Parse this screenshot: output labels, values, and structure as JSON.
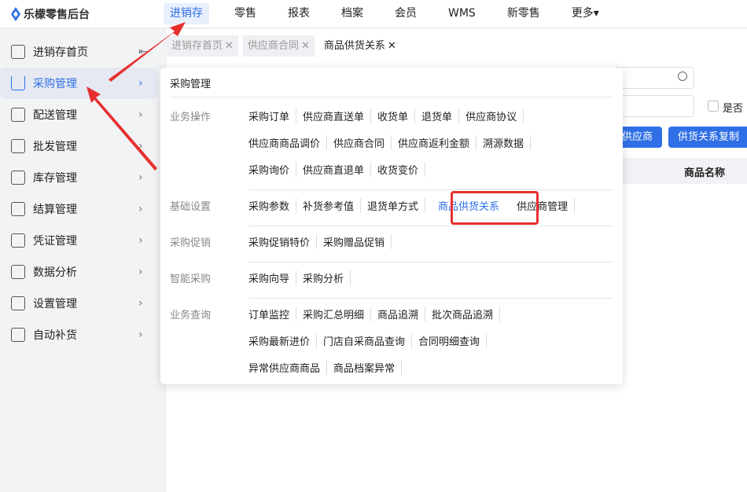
{
  "app": {
    "title": "乐檬零售后台",
    "brand_color": "#2f6fe6"
  },
  "nav": [
    {
      "label": "进销存",
      "active": true
    },
    {
      "label": "零售"
    },
    {
      "label": "报表"
    },
    {
      "label": "档案"
    },
    {
      "label": "会员"
    },
    {
      "label": "WMS"
    },
    {
      "label": "新零售"
    },
    {
      "label": "更多▾"
    }
  ],
  "sidebar": [
    {
      "label": "进销存首页",
      "icon": "home-icon"
    },
    {
      "label": "采购管理",
      "icon": "cart-icon",
      "active": true
    },
    {
      "label": "配送管理",
      "icon": "map-icon"
    },
    {
      "label": "批发管理",
      "icon": "server-icon"
    },
    {
      "label": "库存管理",
      "icon": "box-icon"
    },
    {
      "label": "结算管理",
      "icon": "dollar-icon"
    },
    {
      "label": "凭证管理",
      "icon": "document-icon"
    },
    {
      "label": "数据分析",
      "icon": "chart-icon"
    },
    {
      "label": "设置管理",
      "icon": "settings-icon"
    },
    {
      "label": "自动补货",
      "icon": "replenish-icon"
    }
  ],
  "tabs": [
    {
      "label": "进销存首页"
    },
    {
      "label": "供应商合同"
    },
    {
      "label": "商品供货关系",
      "active": true
    }
  ],
  "page": {
    "checkbox_label": "是否",
    "buttons": [
      "供应商",
      "供货关系复制"
    ],
    "column_header": "商品名称"
  },
  "menu": {
    "title": "采购管理",
    "sections": [
      {
        "label": "业务操作",
        "rows": [
          [
            "采购订单",
            "供应商直送单",
            "收货单",
            "退货单",
            "供应商协议"
          ],
          [
            "供应商商品调价",
            "供应商合同",
            "供应商返利金额",
            "溯源数据"
          ],
          [
            "采购询价",
            "供应商直退单",
            "收货变价"
          ]
        ]
      },
      {
        "label": "基础设置",
        "rows": [
          [
            "采购参数",
            "补货参考值",
            "退货单方式",
            "商品供货关系",
            "供应商管理"
          ]
        ],
        "highlighted": "商品供货关系"
      },
      {
        "label": "采购促销",
        "rows": [
          [
            "采购促销特价",
            "采购赠品促销"
          ]
        ]
      },
      {
        "label": "智能采购",
        "rows": [
          [
            "采购向导",
            "采购分析"
          ]
        ]
      },
      {
        "label": "业务查询",
        "rows": [
          [
            "订单监控",
            "采购汇总明细",
            "商品追溯",
            "批次商品追溯"
          ],
          [
            "采购最新进价",
            "门店自采商品查询",
            "合同明细查询"
          ],
          [
            "异常供应商商品",
            "商品档案异常"
          ]
        ]
      }
    ]
  },
  "annotation_color": "#e63030"
}
